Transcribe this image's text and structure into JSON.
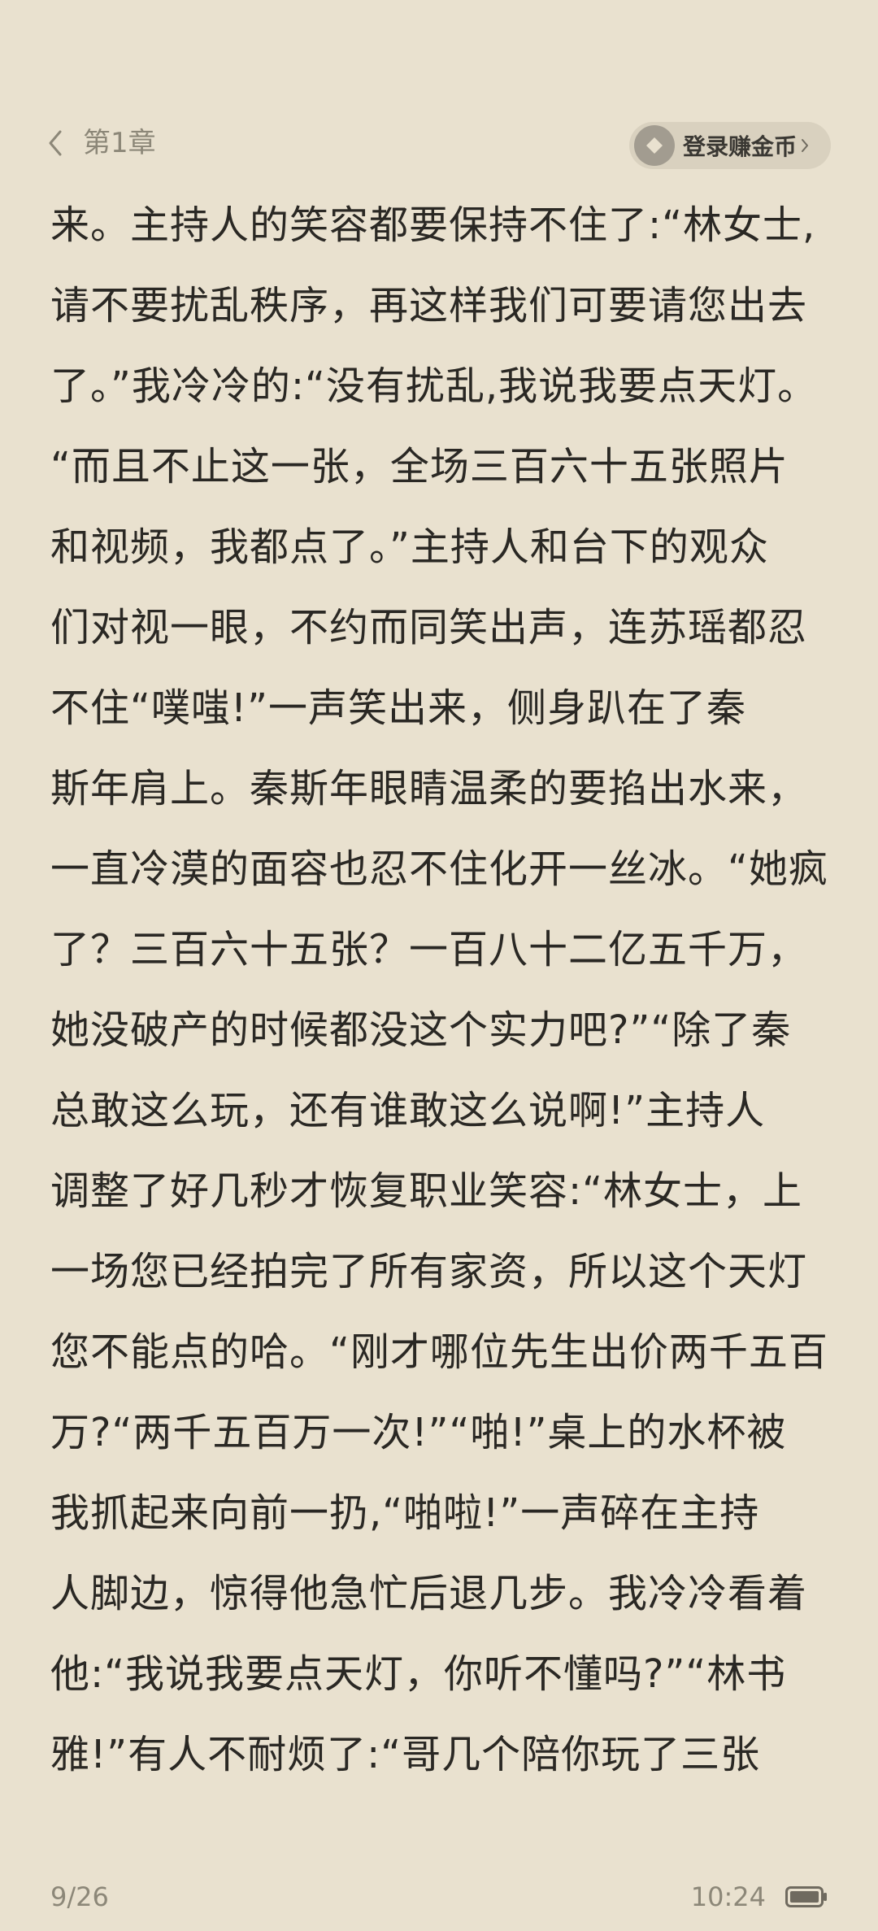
{
  "header": {
    "chapter_title": "第1章",
    "coin_button_label": "登录赚金币"
  },
  "content": {
    "lines": [
      "来。主持人的笑容都要保持不住了:“林女士,",
      "请不要扰乱秩序，再这样我们可要请您出去",
      "了。”我冷冷的:“没有扰乱,我说我要点天灯。",
      "“而且不止这一张，全场三百六十五张照片",
      "和视频，我都点了。”主持人和台下的观众",
      "们对视一眼，不约而同笑出声，连苏瑶都忍",
      "不住“噗嗤!”一声笑出来，侧身趴在了秦",
      "斯年肩上。秦斯年眼睛温柔的要掐出水来，",
      "一直冷漠的面容也忍不住化开一丝冰。“她疯",
      "了？三百六十五张？一百八十二亿五千万，",
      "她没破产的时候都没这个实力吧?”“除了秦",
      "总敢这么玩，还有谁敢这么说啊!”主持人",
      "调整了好几秒才恢复职业笑容:“林女士，上",
      "一场您已经拍完了所有家资，所以这个天灯",
      "您不能点的哈。“刚才哪位先生出价两千五百",
      "万?“两千五百万一次!”“啪!”桌上的水杯被",
      "我抓起来向前一扔,“啪啦!”一声碎在主持",
      "人脚边，惊得他急忙后退几步。我冷冷看着",
      "他:“我说我要点天灯，你听不懂吗?”“林书",
      "雅!”有人不耐烦了:“哥几个陪你玩了三张"
    ]
  },
  "footer": {
    "page_indicator": "9/26",
    "time": "10:24"
  },
  "icons": {
    "back": "chevron-left-icon",
    "coin": "diamond-coin-icon",
    "coin_arrow": "chevron-right-icon",
    "battery": "battery-icon"
  },
  "colors": {
    "background": "#e9e1cf",
    "text": "#2a2824",
    "muted": "#8c8778",
    "pill": "#d9d1bf"
  }
}
